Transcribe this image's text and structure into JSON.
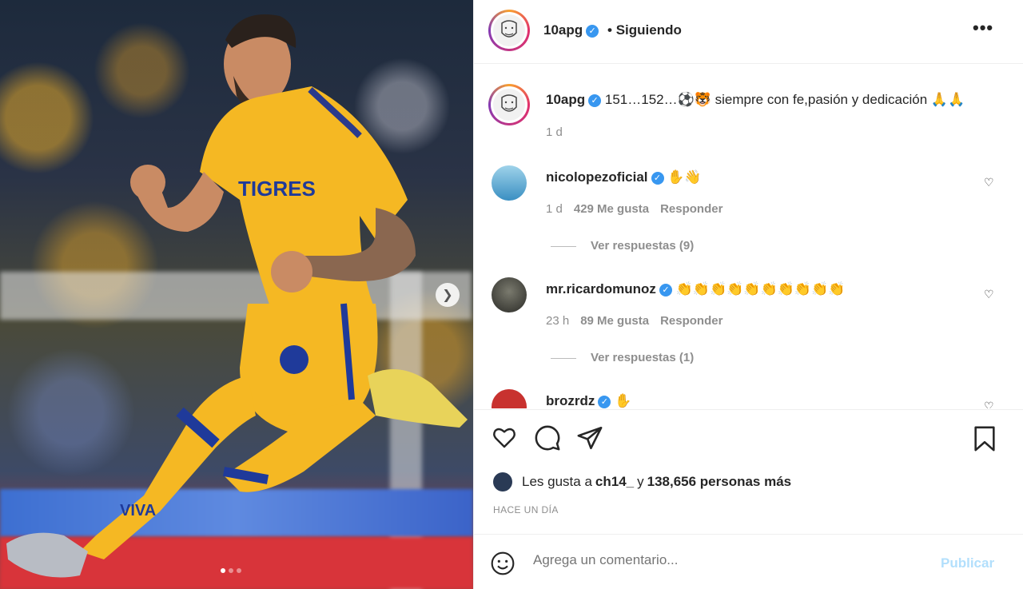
{
  "header": {
    "username": "10apg",
    "separator": "•",
    "follow_label": "Siguiendo",
    "more_label": "•••"
  },
  "caption": {
    "username": "10apg",
    "text": "151…152…⚽🐯 siempre con fe,pasión y dedicación 🙏🙏",
    "time": "1 d"
  },
  "comments": [
    {
      "username": "nicolopezoficial",
      "text": "✋👋",
      "time": "1 d",
      "likes": "429 Me gusta",
      "reply_label": "Responder",
      "view_replies": "Ver respuestas (9)"
    },
    {
      "username": "mr.ricardomunoz",
      "text": "👏👏👏👏👏👏👏👏👏👏",
      "time": "23 h",
      "likes": "89 Me gusta",
      "reply_label": "Responder",
      "view_replies": "Ver respuestas (1)"
    },
    {
      "username": "brozrdz",
      "text": "✋"
    }
  ],
  "likes": {
    "prefix": "Les gusta a",
    "user": "ch14_",
    "connector": "y",
    "count": "138,656 personas más"
  },
  "posted_ago": "HACE UN DÍA",
  "composer": {
    "placeholder": "Agrega un comentario...",
    "publish_label": "Publicar"
  },
  "media": {
    "carousel_count": 3,
    "active_index": 0,
    "jersey_text": "TIGRES",
    "sponsor_text": "VIVA"
  },
  "colors": {
    "verified": "#3897f0",
    "publish_disabled": "#b2dffc",
    "jersey": "#f5b823"
  },
  "icons": [
    "heart-icon",
    "comment-icon",
    "share-icon",
    "bookmark-icon",
    "emoji-icon",
    "chevron-right-icon",
    "verified-icon",
    "more-icon"
  ]
}
